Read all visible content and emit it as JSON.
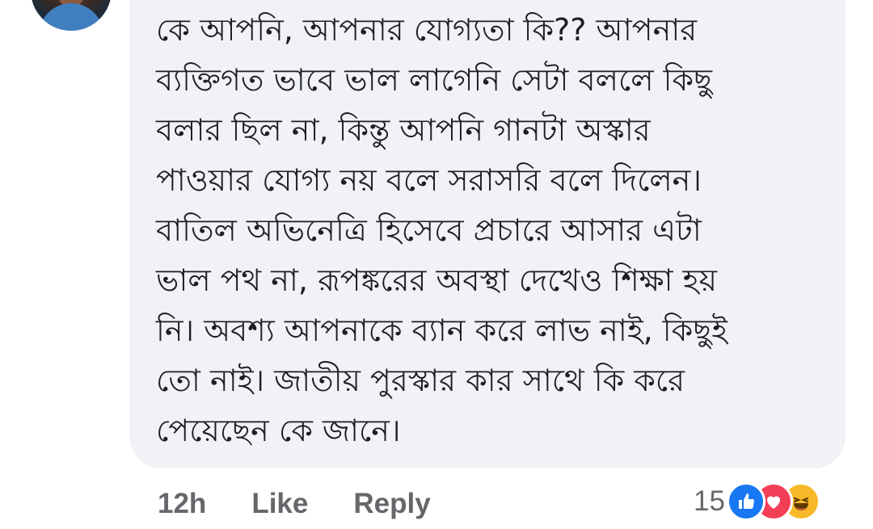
{
  "comment": {
    "lines": [
      "কে আপনি, আপনার যোগ্যতা কি?? আপনার",
      "ব্যক্তিগত ভাবে ভাল লাগেনি সেটা বললে কিছু",
      "বলার ছিল না, কিন্তু আপনি গানটা অস্কার",
      "পাওয়ার যোগ্য নয় বলে সরাসরি বলে দিলেন।",
      "বাতিল অভিনেত্রি হিসেবে প্রচারে আসার এটা",
      "ভাল পথ না, রূপঙ্করের অবস্থা দেখেও শিক্ষা হয়",
      "নি। অবশ্য আপনাকে ব্যান করে লাভ নাই, কিছুই",
      "তো নাই। জাতীয় পুরস্কার কার সাথে কি করে",
      "পেয়েছেন কে জানে।"
    ]
  },
  "actions": {
    "time": "12h",
    "like_label": "Like",
    "reply_label": "Reply"
  },
  "reactions": {
    "count": "15",
    "icons": [
      "like-icon",
      "love-icon",
      "haha-icon"
    ]
  },
  "colors": {
    "bubble": "#f0f2f5",
    "text": "#1c1e21",
    "meta": "#65676b",
    "like": "#1877f2",
    "love": "#f33e58",
    "haha": "#f7b928"
  }
}
